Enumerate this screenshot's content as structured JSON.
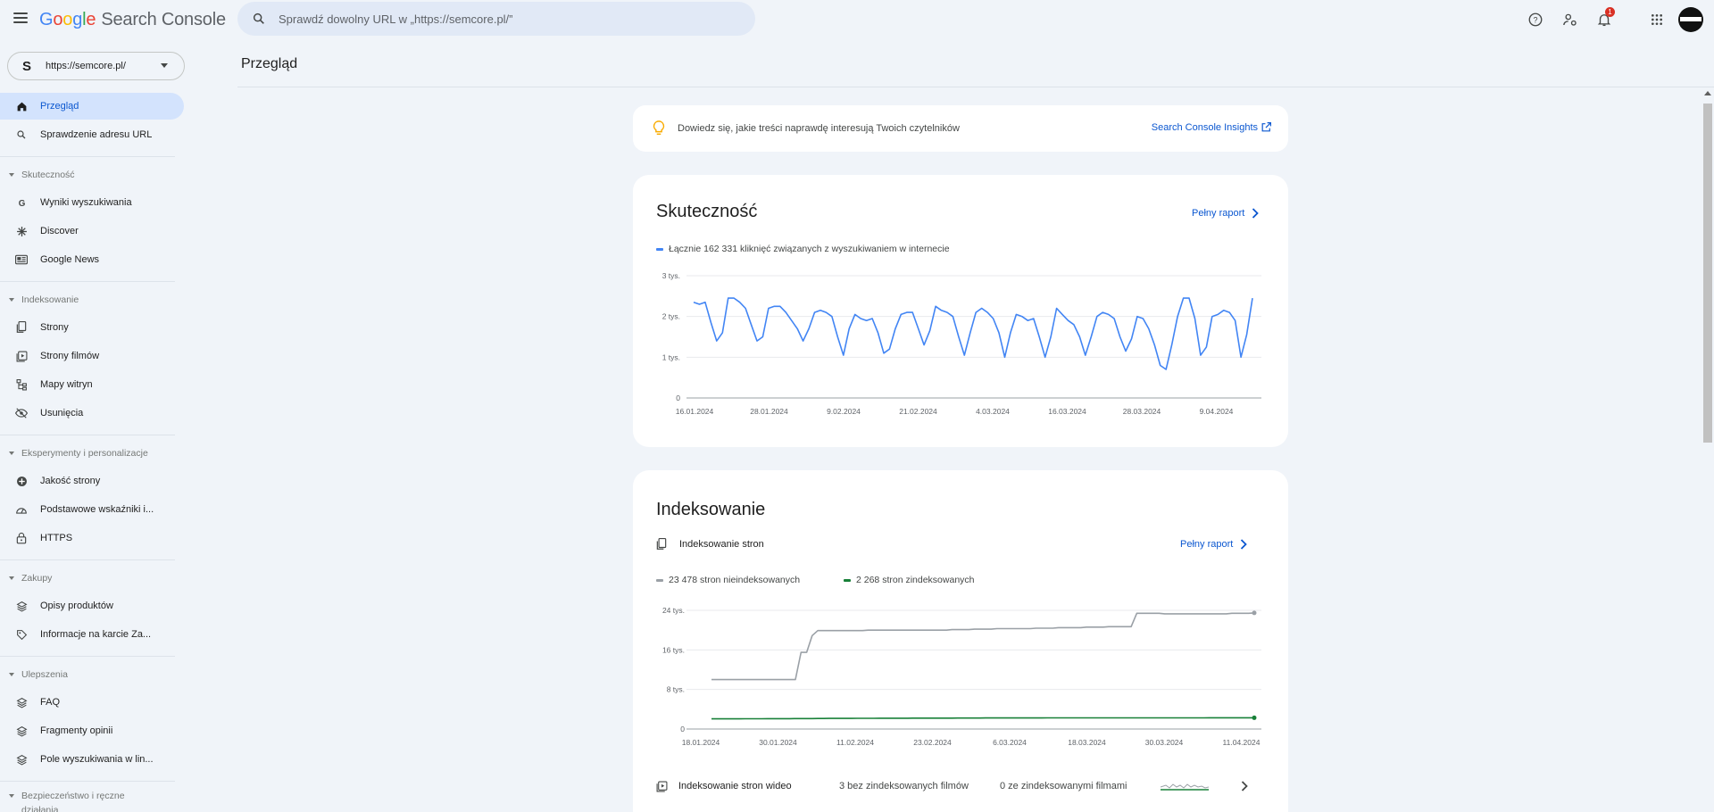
{
  "app": {
    "brand": {
      "g": "G",
      "o1": "o",
      "o2": "o",
      "g2": "g",
      "l": "l",
      "e": "e",
      "product": "Search Console"
    },
    "search_placeholder": "Sprawdź dowolny URL w „https://semcore.pl/”",
    "notification_count": "1"
  },
  "property": {
    "logo": "S",
    "url": "https://semcore.pl/"
  },
  "sidebar": {
    "items": [
      {
        "label": "Przegląd",
        "icon": "home-icon",
        "active": true
      },
      {
        "label": "Sprawdzenie adresu URL",
        "icon": "search-icon"
      }
    ],
    "sections": [
      {
        "title": "Skuteczność",
        "items": [
          {
            "label": "Wyniki wyszukiwania",
            "icon": "google-g-icon"
          },
          {
            "label": "Discover",
            "icon": "asterisk-icon"
          },
          {
            "label": "Google News",
            "icon": "news-icon"
          }
        ]
      },
      {
        "title": "Indeksowanie",
        "items": [
          {
            "label": "Strony",
            "icon": "pages-icon"
          },
          {
            "label": "Strony filmów",
            "icon": "video-pages-icon"
          },
          {
            "label": "Mapy witryn",
            "icon": "sitemap-icon"
          },
          {
            "label": "Usunięcia",
            "icon": "eye-off-icon"
          }
        ]
      },
      {
        "title": "Eksperymenty i personalizacje",
        "items": [
          {
            "label": "Jakość strony",
            "icon": "plus-circle-icon"
          },
          {
            "label": "Podstawowe wskaźniki i...",
            "icon": "speedometer-icon"
          },
          {
            "label": "HTTPS",
            "icon": "lock-icon"
          }
        ]
      },
      {
        "title": "Zakupy",
        "items": [
          {
            "label": "Opisy produktów",
            "icon": "layers-icon"
          },
          {
            "label": "Informacje na karcie Za...",
            "icon": "tag-icon"
          }
        ]
      },
      {
        "title": "Ulepszenia",
        "items": [
          {
            "label": "FAQ",
            "icon": "layers-icon"
          },
          {
            "label": "Fragmenty opinii",
            "icon": "layers-icon"
          },
          {
            "label": "Pole wyszukiwania w lin...",
            "icon": "layers-icon"
          }
        ]
      },
      {
        "title": "Bezpieczeństwo i ręczne działania",
        "items": []
      }
    ]
  },
  "page_title": "Przegląd",
  "insight": {
    "text": "Dowiedz się, jakie treści naprawdę interesują Twoich czytelników",
    "link": "Search Console Insights"
  },
  "performance": {
    "title": "Skuteczność",
    "full_report": "Pełny raport",
    "legend": "Łącznie 162 331 kliknięć związanych z wyszukiwaniem w internecie",
    "line_color": "#4285f4"
  },
  "indexing": {
    "title": "Indeksowanie",
    "sub_title": "Indeksowanie stron",
    "full_report": "Pełny raport",
    "legend_not_indexed": "23 478 stron nieindeksowanych",
    "legend_indexed": "2 268 stron zindeksowanych",
    "not_indexed_color": "#9aa0a6",
    "indexed_color": "#188038",
    "video_label": "Indeksowanie stron wideo",
    "video_stat1": "3 bez zindeksowanych filmów",
    "video_stat2": "0 ze zindeksowanymi filmami"
  },
  "chart_data": [
    {
      "type": "line",
      "title": "Skuteczność",
      "series": [
        {
          "name": "Łącznie 162 331 kliknięć związanych z wyszukiwaniem w internecie",
          "values": [
            2350,
            2300,
            2350,
            1850,
            1400,
            1600,
            2450,
            2450,
            2350,
            2200,
            1800,
            1400,
            1500,
            2200,
            2250,
            2250,
            2100,
            1900,
            1700,
            1400,
            1700,
            2100,
            2150,
            2100,
            2000,
            1500,
            1050,
            1700,
            2050,
            1950,
            1900,
            1950,
            1600,
            1100,
            1200,
            1700,
            2050,
            2100,
            2100,
            1700,
            1300,
            1650,
            2250,
            2150,
            2100,
            2000,
            1500,
            1050,
            1600,
            2100,
            2200,
            2100,
            1950,
            1600,
            1000,
            1600,
            2050,
            2000,
            1900,
            1950,
            1500,
            1000,
            1500,
            2200,
            2050,
            1900,
            1800,
            1500,
            1050,
            1500,
            2000,
            2100,
            2050,
            1950,
            1500,
            1150,
            1450,
            2000,
            1950,
            1700,
            1300,
            800,
            700,
            1300,
            2000,
            2450,
            2450,
            1950,
            1050,
            1250,
            2000,
            2050,
            2150,
            2100,
            1900,
            1000,
            1550,
            2450
          ]
        }
      ],
      "x_tick_labels": [
        "16.01.2024",
        "28.01.2024",
        "9.02.2024",
        "21.02.2024",
        "4.03.2024",
        "16.03.2024",
        "28.03.2024",
        "9.04.2024"
      ],
      "y_tick_labels": [
        "0",
        "1 tys.",
        "2 tys.",
        "3 tys."
      ],
      "ylim": [
        0,
        3000
      ],
      "grid": true
    },
    {
      "type": "line",
      "title": "Indeksowanie stron",
      "series": [
        {
          "name": "23 478 stron nieindeksowanych",
          "values": [
            10000,
            10000,
            10000,
            10000,
            10000,
            10000,
            10000,
            10000,
            10000,
            10000,
            10000,
            10000,
            10000,
            10000,
            10000,
            10000,
            15500,
            15500,
            18900,
            19900,
            19900,
            19900,
            19900,
            19900,
            19900,
            19900,
            19900,
            19900,
            20000,
            20000,
            20000,
            20000,
            20000,
            20000,
            20000,
            20000,
            20000,
            20000,
            20000,
            20000,
            20000,
            20000,
            20000,
            20100,
            20100,
            20100,
            20100,
            20200,
            20200,
            20200,
            20200,
            20300,
            20300,
            20300,
            20300,
            20300,
            20300,
            20300,
            20400,
            20400,
            20400,
            20400,
            20500,
            20500,
            20500,
            20500,
            20500,
            20600,
            20600,
            20600,
            20600,
            20700,
            20700,
            20700,
            20700,
            20700,
            23400,
            23400,
            23400,
            23400,
            23400,
            23300,
            23300,
            23300,
            23300,
            23300,
            23300,
            23300,
            23300,
            23300,
            23300,
            23300,
            23300,
            23400,
            23400,
            23400,
            23400,
            23478
          ]
        },
        {
          "name": "2 268 stron zindeksowanych",
          "values": [
            2050,
            2050,
            2050,
            2050,
            2060,
            2060,
            2070,
            2070,
            2080,
            2080,
            2090,
            2090,
            2100,
            2100,
            2100,
            2110,
            2110,
            2120,
            2120,
            2130,
            2130,
            2140,
            2140,
            2150,
            2150,
            2150,
            2160,
            2160,
            2170,
            2170,
            2180,
            2180,
            2180,
            2190,
            2190,
            2190,
            2200,
            2200,
            2200,
            2200,
            2210,
            2210,
            2210,
            2210,
            2220,
            2220,
            2220,
            2220,
            2220,
            2230,
            2230,
            2230,
            2230,
            2230,
            2240,
            2240,
            2240,
            2240,
            2240,
            2240,
            2250,
            2250,
            2250,
            2250,
            2250,
            2250,
            2250,
            2250,
            2260,
            2260,
            2260,
            2260,
            2260,
            2260,
            2260,
            2260,
            2260,
            2260,
            2260,
            2260,
            2260,
            2260,
            2260,
            2260,
            2260,
            2260,
            2260,
            2260,
            2260,
            2265,
            2265,
            2265,
            2265,
            2265,
            2265,
            2268,
            2268,
            2268
          ]
        }
      ],
      "x_tick_labels": [
        "18.01.2024",
        "30.01.2024",
        "11.02.2024",
        "23.02.2024",
        "6.03.2024",
        "18.03.2024",
        "30.03.2024",
        "11.04.2024"
      ],
      "y_tick_labels": [
        "0",
        "8 tys.",
        "16 tys.",
        "24 tys."
      ],
      "ylim": [
        0,
        24000
      ],
      "grid": true
    }
  ]
}
